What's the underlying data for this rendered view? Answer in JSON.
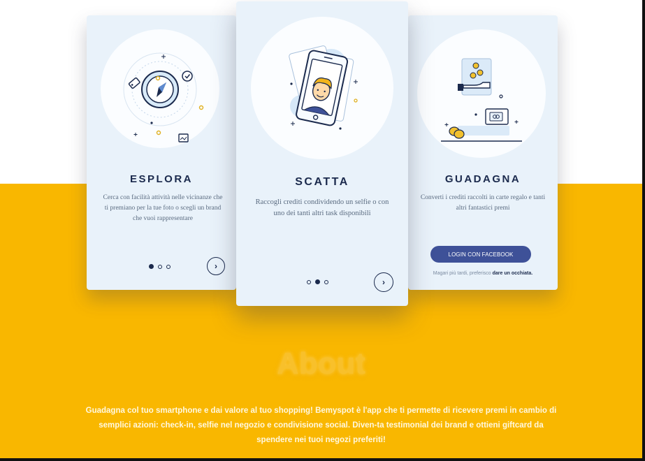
{
  "cards": [
    {
      "title": "ESPLORA",
      "description": "Cerca con facilità attività nelle vicinanze che ti premiano per la tue foto o scegli un brand che vuoi rappresentare",
      "illustration": "compass-icon",
      "pager": {
        "active": 1,
        "total": 3
      },
      "next_icon": "chevron-right-icon"
    },
    {
      "title": "SCATTA",
      "description": "Raccogli crediti condividendo un selfie o con uno dei tanti altri task disponibili",
      "illustration": "smartphone-selfie-icon",
      "pager": {
        "active": 2,
        "total": 3
      },
      "next_icon": "chevron-right-icon"
    },
    {
      "title": "GUADAGNA",
      "description": "Converti i crediti raccolti in carte regalo e tanti altri fantastici premi",
      "illustration": "coins-giftcard-icon",
      "login_button": "LOGIN CON FACEBOOK",
      "later_prefix": "Magari più tardi, preferisco",
      "later_link": "dare un occhiata."
    }
  ],
  "about": {
    "title": "About",
    "text": "Guadagna col tuo smartphone e dai valore al tuo shopping! Bemyspot è l'app che ti permette di ricevere premi in cambio di semplici azioni: check-in, selfie nel negozio e condivisione social. Diven-ta testimonial dei brand e ottieni giftcard da spendere nei tuoi negozi preferiti!"
  },
  "colors": {
    "yellow": "#f9b700",
    "navy": "#1b2a4d",
    "card_bg": "#e9f2fa",
    "facebook_blue": "#3e5198"
  }
}
